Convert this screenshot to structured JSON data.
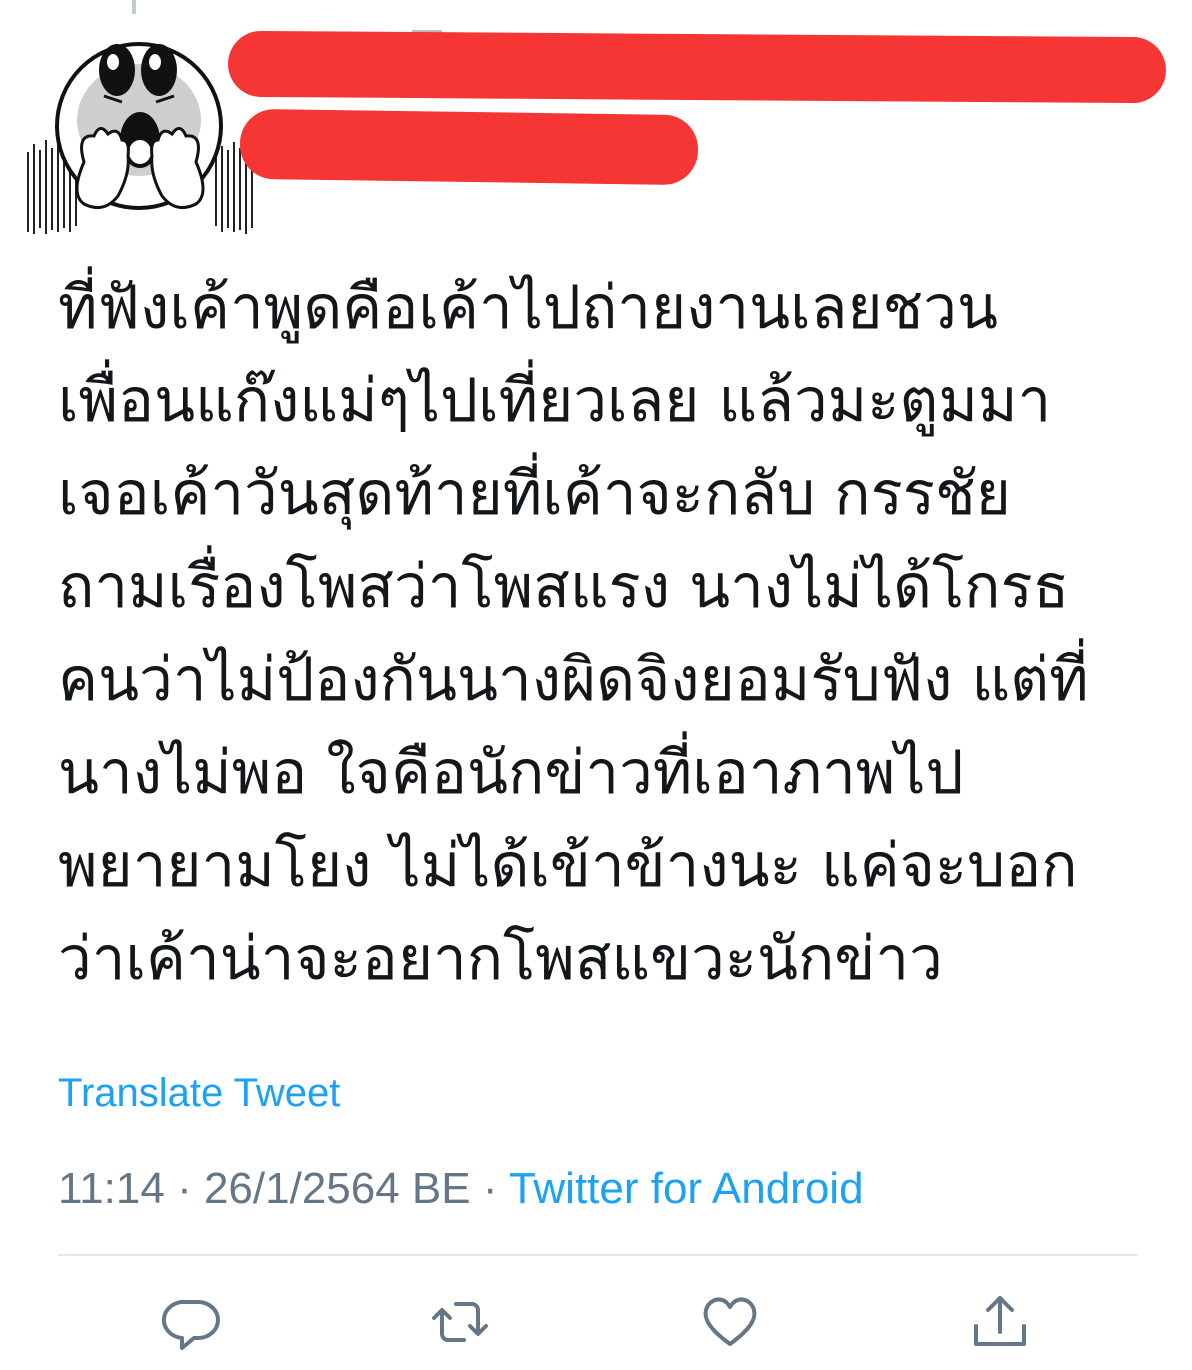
{
  "tweet": {
    "text_lines": [
      "ที่ฟังเค้าพูดคือเค้าไปถ่ายงานเลยชวน",
      "เพื่อนแก๊งแม่ๆไปเที่ยวเลย แล้วมะตูมมา",
      "เจอเค้าวันสุดท้ายที่เค้าจะกลับ กรรชัย",
      "ถามเรื่องโพสว่าโพสแรง นางไม่ได้โกรธ",
      "คนว่าไม่ป้องกันนางผิดจิงยอมรับฟัง แต่ที่",
      "นางไม่พอ ใจคือนักข่าวที่เอาภาพไป",
      "พยายามโยง ไม่ได้เข้าข้างนะ แค่จะบอก",
      "ว่าเค้าน่าจะอยากโพสแขวะนักข่าว"
    ],
    "translate_label": "Translate Tweet",
    "time": "11:14",
    "separator": " · ",
    "date": "26/1/2564 BE",
    "source": "Twitter for Android"
  },
  "author": {
    "name": "",
    "handle": "",
    "redacted": true,
    "avatar_icon": "shocked-cartoon-face-icon"
  },
  "actions": [
    {
      "name": "reply",
      "icon": "reply-icon"
    },
    {
      "name": "retweet",
      "icon": "retweet-icon"
    },
    {
      "name": "like",
      "icon": "heart-icon"
    },
    {
      "name": "share",
      "icon": "share-icon"
    }
  ],
  "colors": {
    "link": "#1da1f2",
    "meta": "#657786",
    "text": "#14171a",
    "redaction": "#f63535",
    "divider": "#e1e8ed"
  }
}
